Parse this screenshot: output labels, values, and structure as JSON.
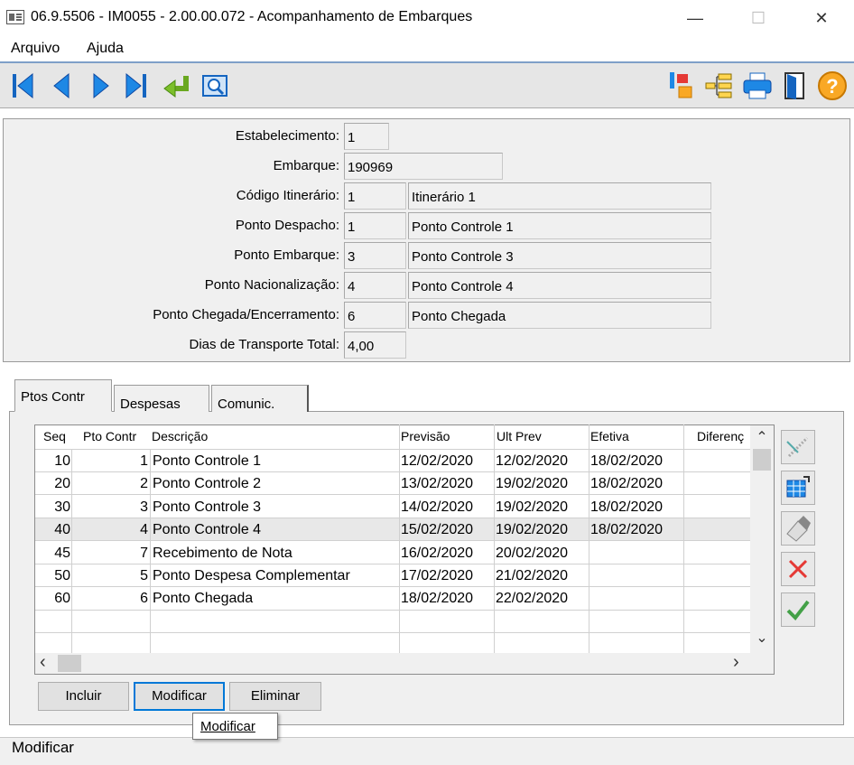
{
  "window": {
    "title": "06.9.5506 - IM0055 - 2.00.00.072 - Acompanhamento de Embarques",
    "minimize": "—",
    "maximize": "☐",
    "close": "✕"
  },
  "menu": {
    "items": [
      "Arquivo",
      "Ajuda"
    ]
  },
  "toolbar": {
    "nav_icons": [
      "first-icon",
      "previous-icon",
      "next-icon",
      "last-icon",
      "enter-icon",
      "search-icon"
    ],
    "right_icons": [
      "transfer-icon",
      "tree-icon",
      "print-icon",
      "exit-door-icon",
      "help-icon"
    ],
    "help_glyph": "?"
  },
  "header": {
    "estabelecimento": {
      "label": "Estabelecimento:",
      "value": "1"
    },
    "embarque": {
      "label": "Embarque:",
      "value": "190969"
    },
    "itinerario": {
      "label": "Código Itinerário:",
      "code": "1",
      "desc": "Itinerário 1"
    },
    "despacho": {
      "label": "Ponto Despacho:",
      "code": "1",
      "desc": "Ponto Controle 1"
    },
    "ponto_embarque": {
      "label": "Ponto Embarque:",
      "code": "3",
      "desc": "Ponto Controle 3"
    },
    "nacionalizacao": {
      "label": "Ponto Nacionalização:",
      "code": "4",
      "desc": "Ponto Controle 4"
    },
    "chegada": {
      "label": "Ponto Chegada/Encerramento:",
      "code": "6",
      "desc": "Ponto Chegada"
    },
    "dias": {
      "label": "Dias de Transporte Total:",
      "value": "4,00"
    }
  },
  "tabs": [
    "Ptos Contr",
    "Despesas",
    "Comunic."
  ],
  "grid": {
    "columns": [
      "Seq",
      "Pto Contr",
      "Descrição",
      "Previsão",
      "Ult Prev",
      "Efetiva",
      "Diferenç"
    ],
    "rows": [
      {
        "seq": "10",
        "pto": "1",
        "desc": "Ponto Controle 1",
        "prev": "12/02/2020",
        "ult": "12/02/2020",
        "efet": "18/02/2020"
      },
      {
        "seq": "20",
        "pto": "2",
        "desc": "Ponto Controle 2",
        "prev": "13/02/2020",
        "ult": "19/02/2020",
        "efet": "18/02/2020"
      },
      {
        "seq": "30",
        "pto": "3",
        "desc": "Ponto Controle 3",
        "prev": "14/02/2020",
        "ult": "19/02/2020",
        "efet": "18/02/2020"
      },
      {
        "seq": "40",
        "pto": "4",
        "desc": "Ponto Controle 4",
        "prev": "15/02/2020",
        "ult": "19/02/2020",
        "efet": "18/02/2020"
      },
      {
        "seq": "45",
        "pto": "7",
        "desc": "Recebimento de Nota",
        "prev": "16/02/2020",
        "ult": "20/02/2020",
        "efet": ""
      },
      {
        "seq": "50",
        "pto": "5",
        "desc": "Ponto Despesa Complementar",
        "prev": "17/02/2020",
        "ult": "21/02/2020",
        "efet": ""
      },
      {
        "seq": "60",
        "pto": "6",
        "desc": "Ponto Chegada",
        "prev": "18/02/2020",
        "ult": "22/02/2020",
        "efet": ""
      }
    ],
    "selected_row": 3,
    "scroll_up": "⌃",
    "scroll_down": "⌄",
    "scroll_left": "‹",
    "scroll_right": "›"
  },
  "side_buttons": [
    "edit-line-icon",
    "grid-edit-icon",
    "erase-icon",
    "cancel-icon",
    "confirm-icon"
  ],
  "buttons": {
    "incluir": "Incluir",
    "modificar": "Modificar",
    "eliminar": "Eliminar"
  },
  "tooltip": "Modificar",
  "status": "Modificar"
}
